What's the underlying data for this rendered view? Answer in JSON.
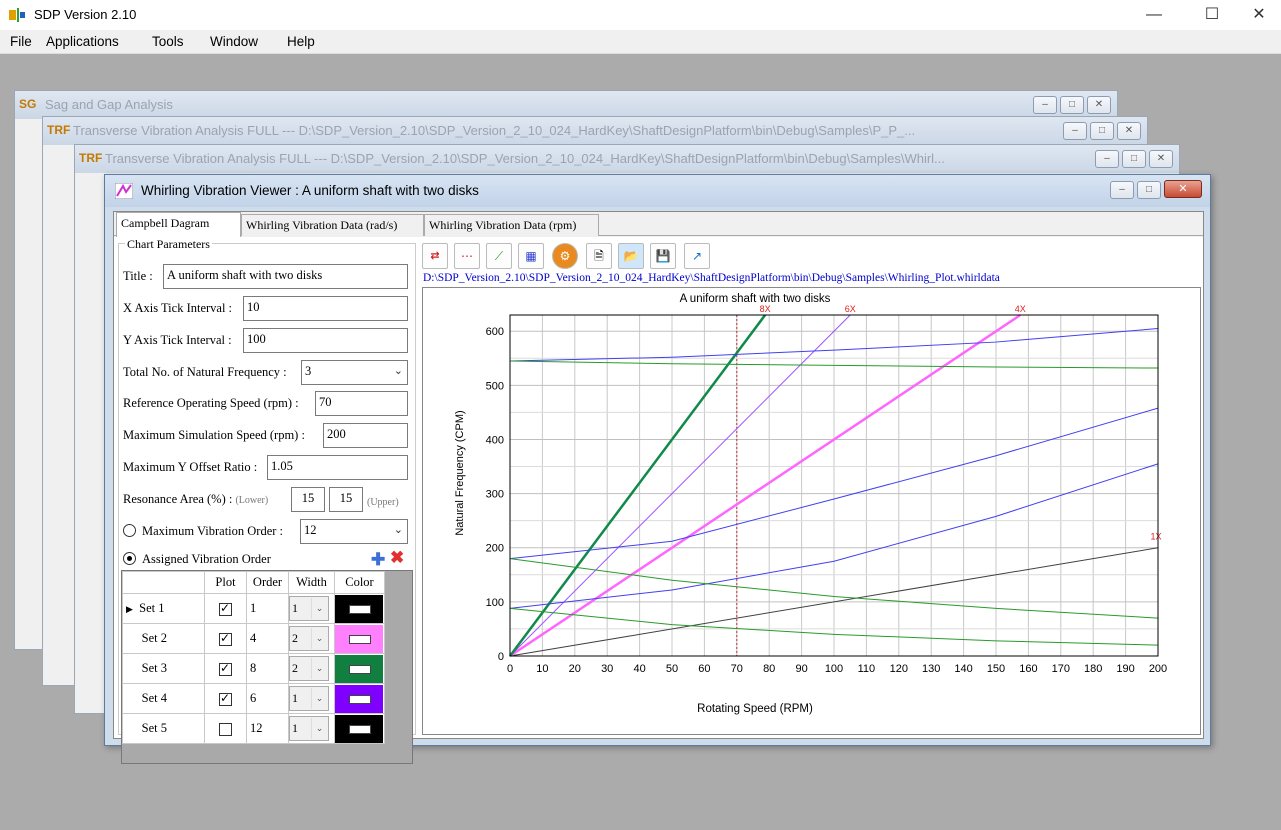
{
  "app": {
    "title": "SDP Version 2.10"
  },
  "menu": [
    "File",
    "Applications",
    "Tools",
    "Window",
    "Help"
  ],
  "bg_windows": [
    {
      "icon": "SG",
      "title": "Sag and Gap Analysis"
    },
    {
      "icon": "TRF",
      "title": "Transverse Vibration Analysis FULL --- D:\\SDP_Version_2.10\\SDP_Version_2_10_024_HardKey\\ShaftDesignPlatform\\bin\\Debug\\Samples\\P_P_..."
    },
    {
      "icon": "TRF",
      "title": "Transverse Vibration Analysis FULL --- D:\\SDP_Version_2.10\\SDP_Version_2_10_024_HardKey\\ShaftDesignPlatform\\bin\\Debug\\Samples\\Whirl..."
    }
  ],
  "viewer": {
    "title": "Whirling Vibration Viewer : A uniform shaft with two disks",
    "tabs": [
      "Campbell Dagram",
      "Whirling Vibration Data (rad/s)",
      "Whirling Vibration Data (rpm)"
    ],
    "group_label": "Chart Parameters",
    "params": {
      "title_label": "Title :",
      "title_value": "A uniform shaft with two disks",
      "xtick_label": "X Axis Tick Interval :",
      "xtick_value": "10",
      "ytick_label": "Y Axis Tick Interval :",
      "ytick_value": "100",
      "natfreq_label": "Total No. of Natural Frequency :",
      "natfreq_value": "3",
      "refspeed_label": "Reference Operating Speed (rpm) :",
      "refspeed_value": "70",
      "maxsim_label": "Maximum Simulation Speed (rpm) :",
      "maxsim_value": "200",
      "maxy_label": "Maximum Y Offset Ratio :",
      "maxy_value": "1.05",
      "res_label": "Resonance Area (%) :",
      "res_lower_hint": "(Lower)",
      "res_lower": "15",
      "res_upper": "15",
      "res_upper_hint": "(Upper)",
      "maxorder_label": "Maximum Vibration Order :",
      "maxorder_value": "12",
      "assigned_label": "Assigned Vibration Order"
    },
    "grid": {
      "headers": [
        "Plot",
        "Order",
        "Width",
        "Color"
      ],
      "rows": [
        {
          "name": "Set 1",
          "plot": true,
          "order": "1",
          "width": "1",
          "color": "#000000",
          "current": true
        },
        {
          "name": "Set 2",
          "plot": true,
          "order": "4",
          "width": "2",
          "color": "#ff80ff"
        },
        {
          "name": "Set 3",
          "plot": true,
          "order": "8",
          "width": "2",
          "color": "#107f3f"
        },
        {
          "name": "Set 4",
          "plot": true,
          "order": "6",
          "width": "1",
          "color": "#8000ff"
        },
        {
          "name": "Set 5",
          "plot": false,
          "order": "12",
          "width": "1",
          "color": "#000000"
        }
      ]
    },
    "file_path": "D:\\SDP_Version_2.10\\SDP_Version_2_10_024_HardKey\\ShaftDesignPlatform\\bin\\Debug\\Samples\\Whirling_Plot.whirldata"
  },
  "chart_data": {
    "type": "line",
    "title": "A uniform shaft with two disks",
    "xlabel": "Rotating Speed (RPM)",
    "ylabel": "Natural Frequency (CPM)",
    "xlim": [
      0,
      200
    ],
    "ylim": [
      0,
      630
    ],
    "xticks": [
      0,
      10,
      20,
      30,
      40,
      50,
      60,
      70,
      80,
      90,
      100,
      110,
      120,
      130,
      140,
      150,
      160,
      170,
      180,
      190,
      200
    ],
    "yticks": [
      0,
      100,
      200,
      300,
      400,
      500,
      600
    ],
    "reference_speed": 70,
    "order_lines": [
      {
        "name": "1X",
        "order": 1,
        "color": "#404040"
      },
      {
        "name": "4X",
        "order": 4,
        "color": "#ff66ff"
      },
      {
        "name": "6X",
        "order": 6,
        "color": "#a050ff"
      },
      {
        "name": "8X",
        "order": 8,
        "color": "#108a4a"
      }
    ],
    "forward_whirl": [
      {
        "x": [
          0,
          50,
          100,
          150,
          200
        ],
        "y": [
          88,
          122,
          175,
          258,
          355
        ]
      },
      {
        "x": [
          0,
          50,
          100,
          150,
          200
        ],
        "y": [
          180,
          212,
          290,
          370,
          458
        ]
      },
      {
        "x": [
          0,
          50,
          100,
          150,
          200
        ],
        "y": [
          545,
          552,
          565,
          580,
          605
        ]
      }
    ],
    "backward_whirl": [
      {
        "x": [
          0,
          50,
          100,
          150,
          200
        ],
        "y": [
          88,
          58,
          40,
          28,
          20
        ]
      },
      {
        "x": [
          0,
          50,
          100,
          150,
          200
        ],
        "y": [
          180,
          140,
          110,
          88,
          70
        ]
      },
      {
        "x": [
          0,
          50,
          100,
          150,
          200
        ],
        "y": [
          545,
          540,
          537,
          534,
          532
        ]
      }
    ],
    "forward_color": "#4040f0",
    "backward_color": "#2a9a2a"
  }
}
